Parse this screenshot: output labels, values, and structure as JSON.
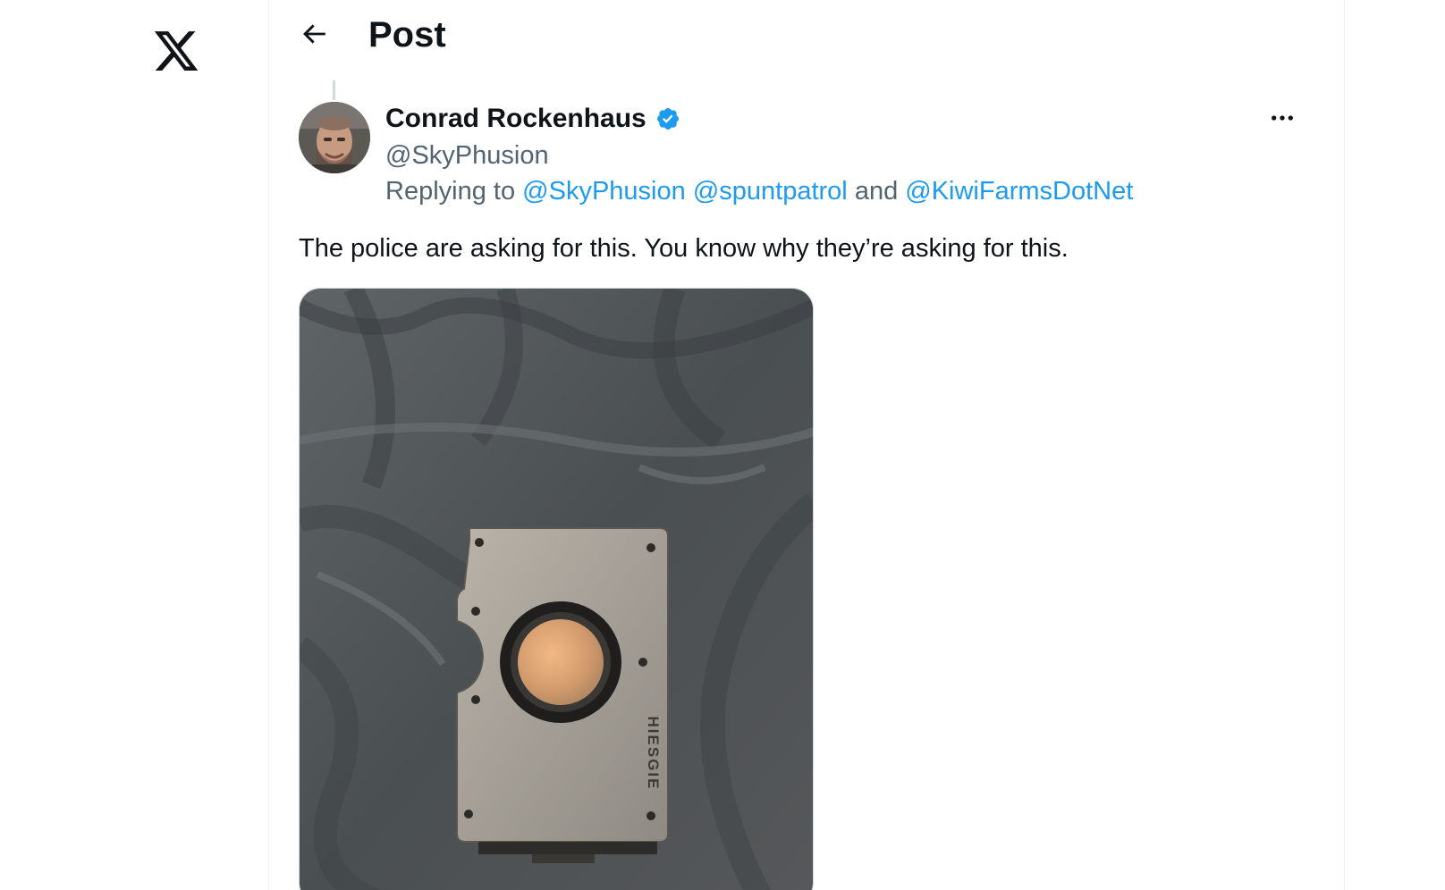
{
  "header": {
    "title": "Post"
  },
  "tweet": {
    "author_name": "Conrad Rockenhaus",
    "author_handle": "@SkyPhusion",
    "reply_prefix": "Replying to",
    "reply_mentions": [
      "@SkyPhusion",
      "@spuntpatrol",
      "@KiwiFarmsDotNet"
    ],
    "reply_conjunction": "and",
    "text": "The police are asking for this. You know why they’re asking for this.",
    "media_brand_text": "HIESGIE"
  },
  "colors": {
    "accent": "#1d9bf0",
    "secondary_text": "#536471",
    "primary_text": "#0f1419",
    "border": "#eff3f4"
  },
  "icons": {
    "logo": "x-logo-icon",
    "back": "back-arrow-icon",
    "verified": "verified-badge-icon",
    "more": "more-options-icon"
  }
}
